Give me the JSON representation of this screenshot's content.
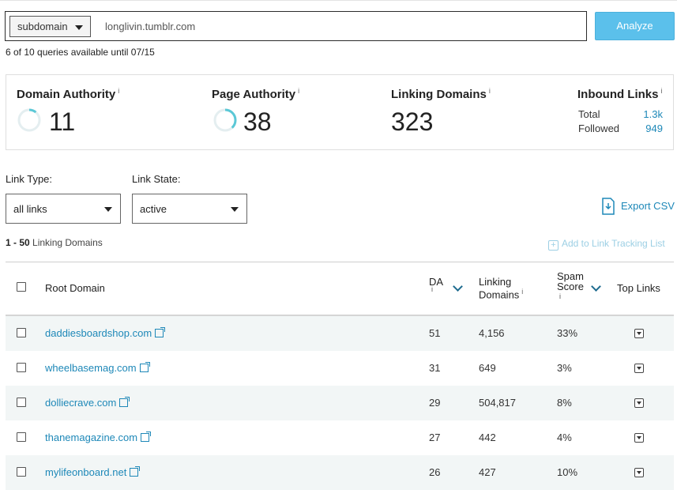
{
  "search": {
    "scope_selected": "subdomain",
    "query_value": "longlivin.tumblr.com",
    "analyze_label": "Analyze",
    "quota_text": "6 of 10 queries available until 07/15"
  },
  "metrics": {
    "domain_authority": {
      "label": "Domain Authority",
      "info": "i",
      "value": "11",
      "ring_fraction": 0.11
    },
    "page_authority": {
      "label": "Page Authority",
      "info": "i",
      "value": "38",
      "ring_fraction": 0.38
    },
    "linking_domains": {
      "label": "Linking Domains",
      "info": "i",
      "value": "323"
    },
    "inbound_links": {
      "label": "Inbound Links",
      "info": "i",
      "total_label": "Total",
      "total_value": "1.3k",
      "followed_label": "Followed",
      "followed_value": "949"
    }
  },
  "filters": {
    "link_type_label": "Link Type:",
    "link_type_value": "all links",
    "link_state_label": "Link State:",
    "link_state_value": "active",
    "export_label": "Export CSV"
  },
  "results": {
    "range": "1 - 50",
    "range_suffix": "Linking Domains",
    "add_tracking": "Add to Link Tracking List"
  },
  "table": {
    "headers": {
      "root_domain": "Root Domain",
      "da": "DA",
      "da_info": "i",
      "linking_1": "Linking",
      "linking_2": "Domains",
      "linking_info": "i",
      "spam_1": "Spam",
      "spam_2": "Score",
      "spam_info": "i",
      "top_links": "Top Links"
    },
    "rows": [
      {
        "domain": "daddiesboardshop.com",
        "da": "51",
        "linking": "4,156",
        "spam": "33%"
      },
      {
        "domain": "wheelbasemag.com",
        "da": "31",
        "linking": "649",
        "spam": "3%"
      },
      {
        "domain": "dolliecrave.com",
        "da": "29",
        "linking": "504,817",
        "spam": "8%"
      },
      {
        "domain": "thanemagazine.com",
        "da": "27",
        "linking": "442",
        "spam": "4%"
      },
      {
        "domain": "mylifeonboard.net",
        "da": "26",
        "linking": "427",
        "spam": "10%"
      }
    ]
  },
  "colors": {
    "accent": "#1e88b8",
    "analyze_bg": "#5bc0eb",
    "ring": "#5bc8d6",
    "row_shade": "#f2f6f6"
  }
}
